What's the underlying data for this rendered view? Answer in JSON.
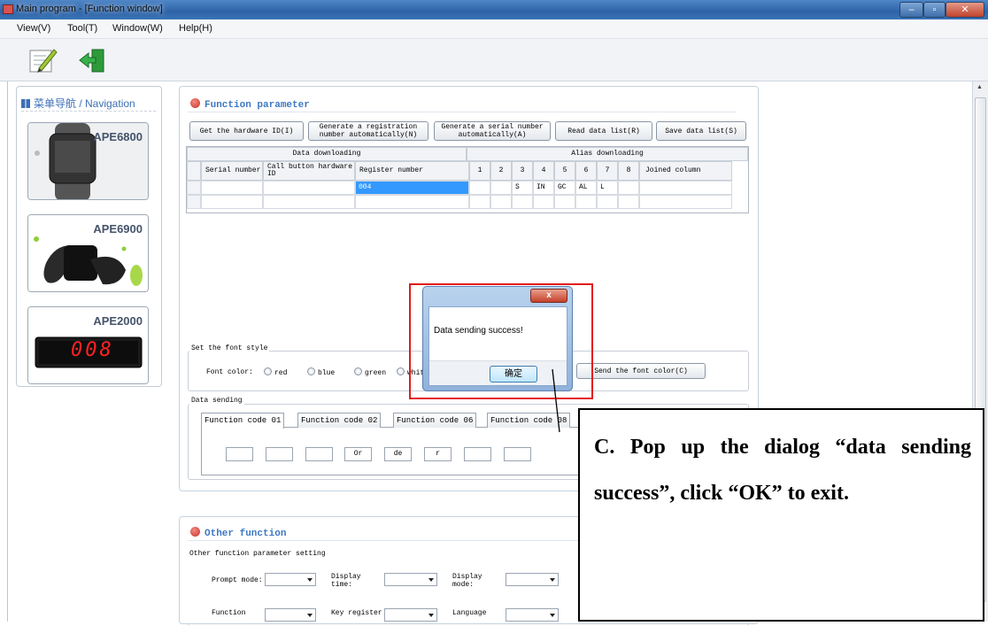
{
  "window": {
    "title": "Main program - [Function window]",
    "minimize": "–",
    "maximize": "▫",
    "close": "✕"
  },
  "menu": [
    "View(V)",
    "Tool(T)",
    "Window(W)",
    "Help(H)"
  ],
  "navigation": {
    "title": "菜单导航 / Navigation",
    "products": [
      "APE6800",
      "APE6900",
      "APE2000"
    ],
    "display_digits": "008"
  },
  "function_panel": {
    "title": "Function parameter",
    "buttons": {
      "hardware_id": "Get the hardware ID(I)",
      "registration": "Generate a registration number automatically(N)",
      "serial": "Generate a serial number automatically(A)",
      "read_list": "Read data list(R)",
      "save_list": "Save data list(S)"
    },
    "grid": {
      "group_headers": [
        "Data downloading",
        "Alias downloading"
      ],
      "columns": [
        "Serial number",
        "Call button hardware ID",
        "Register number",
        "1",
        "2",
        "3",
        "4",
        "5",
        "6",
        "7",
        "8",
        "Joined column"
      ],
      "rows": [
        [
          "",
          "",
          "004",
          "",
          "",
          "S",
          "IN",
          "GC",
          "AL",
          "L",
          "",
          ""
        ],
        [
          "",
          "",
          "",
          "",
          "",
          "",
          "",
          "",
          "",
          "",
          "",
          ""
        ]
      ]
    },
    "font_style": {
      "caption": "Set the font style",
      "label": "Font color:",
      "options": [
        "red",
        "blue",
        "green",
        "white"
      ],
      "send_button": "Send the font color(C)"
    },
    "data_sending": {
      "caption": "Data sending",
      "tabs": [
        "Function code 01",
        "Function code 02",
        "Function code 06",
        "Function code 08"
      ],
      "boxes": [
        "",
        "",
        "",
        "Or",
        "de",
        "r",
        "",
        ""
      ]
    }
  },
  "other_panel": {
    "title": "Other function",
    "caption": "Other function parameter setting",
    "labels": [
      "Prompt mode:",
      "Display time:",
      "Display mode:",
      "Function",
      "Key register",
      "Language"
    ]
  },
  "dialog": {
    "close": "x",
    "message": "Data sending success!",
    "ok": "确定"
  },
  "annotation": {
    "text": "C. Pop up the dialog “data sending success”, click “OK” to exit."
  }
}
